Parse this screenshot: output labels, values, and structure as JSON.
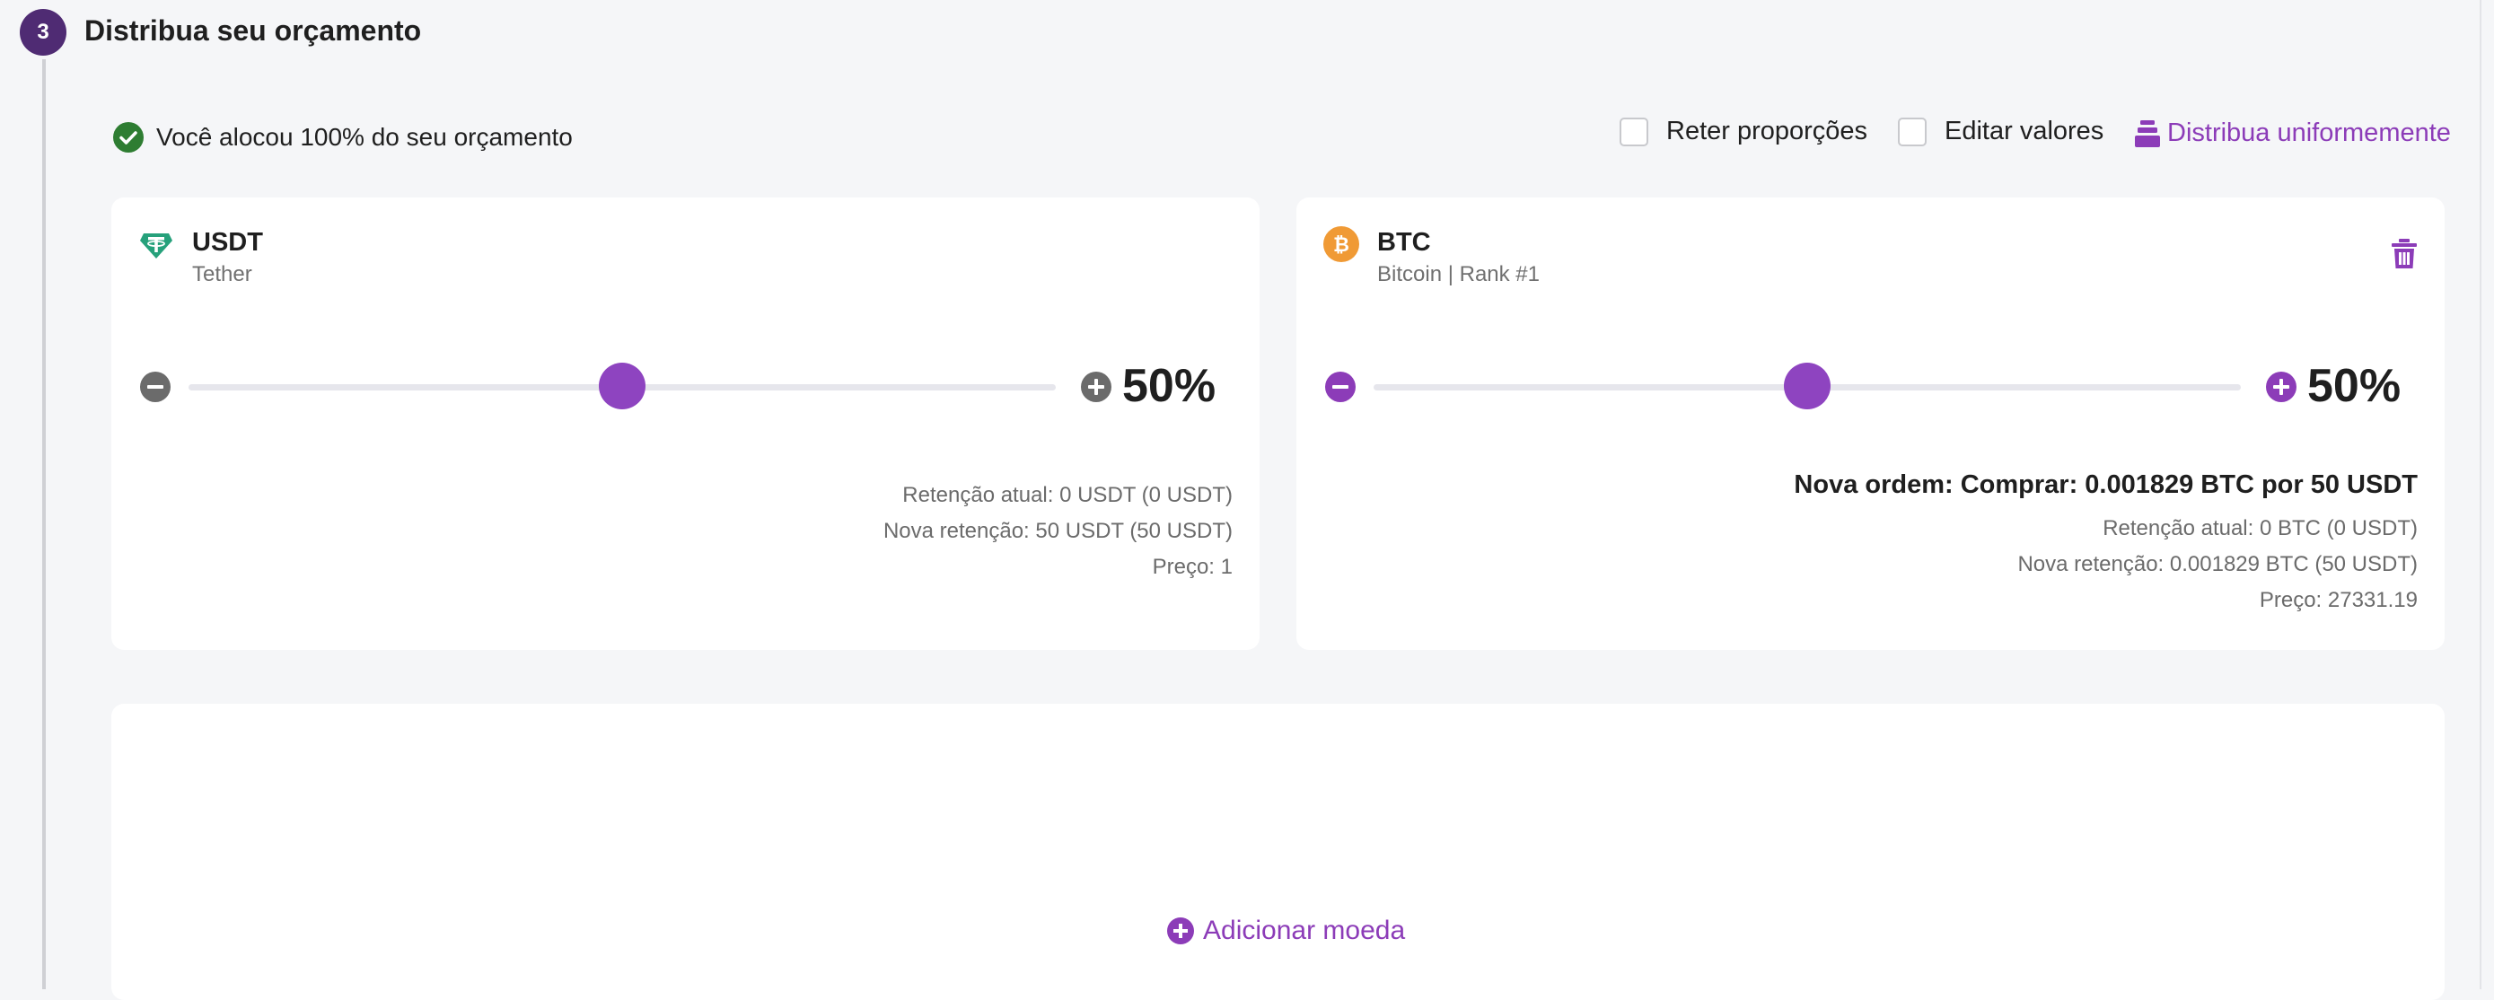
{
  "step": {
    "number": "3",
    "title": "Distribua seu orçamento"
  },
  "allocation": {
    "status_text": "Você alocou 100% do seu orçamento",
    "status_color": "#2e7d32"
  },
  "options": {
    "retain_label": "Reter proporções",
    "edit_label": "Editar valores",
    "distribute_label": "Distribua uniformemente"
  },
  "accent_color": "#8c3cb8",
  "coins": [
    {
      "symbol": "USDT",
      "name": "Tether",
      "icon": "tether-icon",
      "icon_color": "#26a17b",
      "percent": "50%",
      "slider_value": 0.5,
      "order": "",
      "retention_current": "Retenção atual: 0 USDT (0 USDT)",
      "retention_new": "Nova retenção: 50 USDT (50 USDT)",
      "price": "Preço: 1"
    },
    {
      "symbol": "BTC",
      "name": "Bitcoin | Rank #1",
      "icon": "bitcoin-icon",
      "icon_color": "#f09a35",
      "percent": "50%",
      "slider_value": 0.5,
      "order": "Nova ordem: Comprar: 0.001829 BTC por 50 USDT",
      "retention_current": "Retenção atual: 0 BTC (0 USDT)",
      "retention_new": "Nova retenção: 0.001829 BTC (50 USDT)",
      "price": "Preço: 27331.19"
    }
  ],
  "add_coin_label": "Adicionar moeda"
}
